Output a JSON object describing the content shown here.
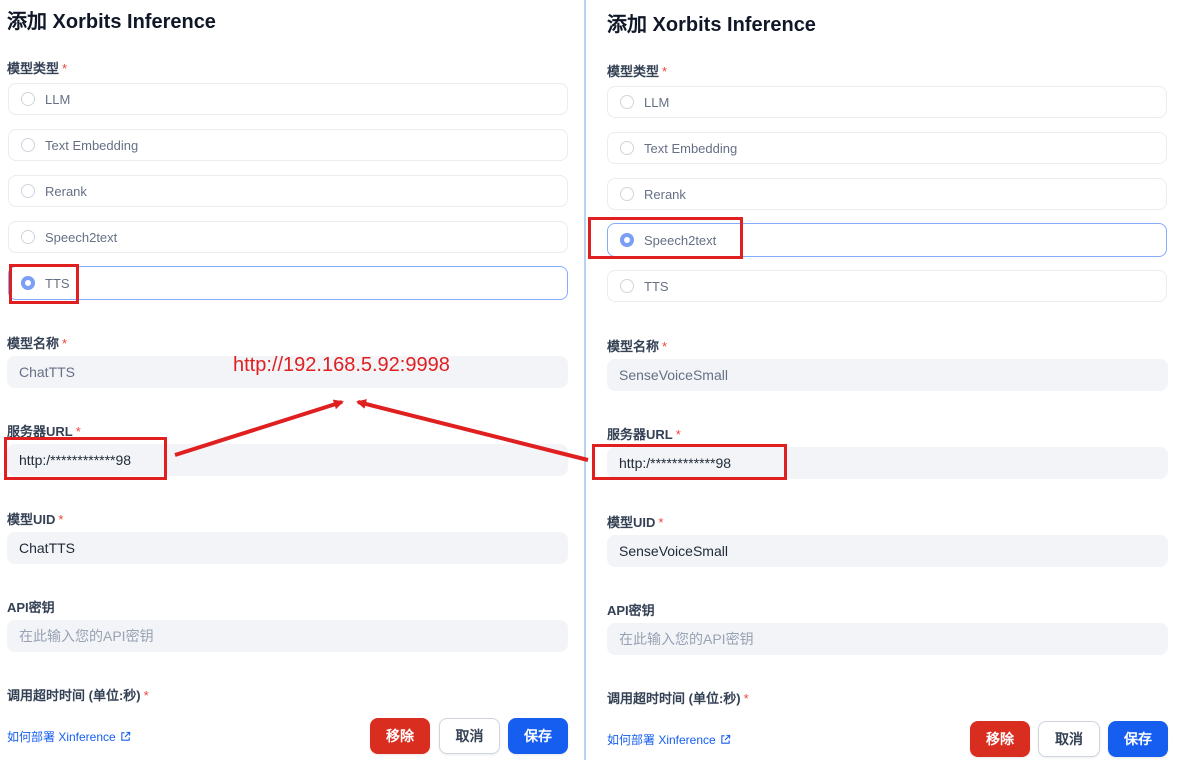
{
  "left": {
    "title": "添加 Xorbits Inference",
    "model_type_label": "模型类型",
    "model_types": [
      {
        "label": "LLM",
        "selected": false
      },
      {
        "label": "Text Embedding",
        "selected": false
      },
      {
        "label": "Rerank",
        "selected": false
      },
      {
        "label": "Speech2text",
        "selected": false
      },
      {
        "label": "TTS",
        "selected": true
      }
    ],
    "model_name_label": "模型名称",
    "model_name_value": "ChatTTS",
    "server_url_label": "服务器URL",
    "server_url_value": "http:/************98",
    "model_uid_label": "模型UID",
    "model_uid_value": "ChatTTS",
    "api_key_label": "API密钥",
    "api_key_placeholder": "在此输入您的API密钥",
    "timeout_label": "调用超时时间 (单位:秒)",
    "deploy_link": "如何部署 Xinference",
    "remove_label": "移除",
    "cancel_label": "取消",
    "save_label": "保存"
  },
  "right": {
    "title": "添加 Xorbits Inference",
    "model_type_label": "模型类型",
    "model_types": [
      {
        "label": "LLM",
        "selected": false
      },
      {
        "label": "Text Embedding",
        "selected": false
      },
      {
        "label": "Rerank",
        "selected": false
      },
      {
        "label": "Speech2text",
        "selected": true
      },
      {
        "label": "TTS",
        "selected": false
      }
    ],
    "model_name_label": "模型名称",
    "model_name_value": "SenseVoiceSmall",
    "server_url_label": "服务器URL",
    "server_url_value": "http:/************98",
    "model_uid_label": "模型UID",
    "model_uid_value": "SenseVoiceSmall",
    "api_key_label": "API密钥",
    "api_key_placeholder": "在此输入您的API密钥",
    "timeout_label": "调用超时时间 (单位:秒)",
    "deploy_link": "如何部署 Xinference",
    "remove_label": "移除",
    "cancel_label": "取消",
    "save_label": "保存"
  },
  "required_mark": "*",
  "annotation": {
    "url_text": "http://192.168.5.92:9998",
    "color": "#e02020"
  },
  "colors": {
    "primary": "#155eef",
    "danger": "#d92d20",
    "radio_selected": "#7a9ff5"
  },
  "icons": {
    "external_link": "external-link-icon"
  }
}
